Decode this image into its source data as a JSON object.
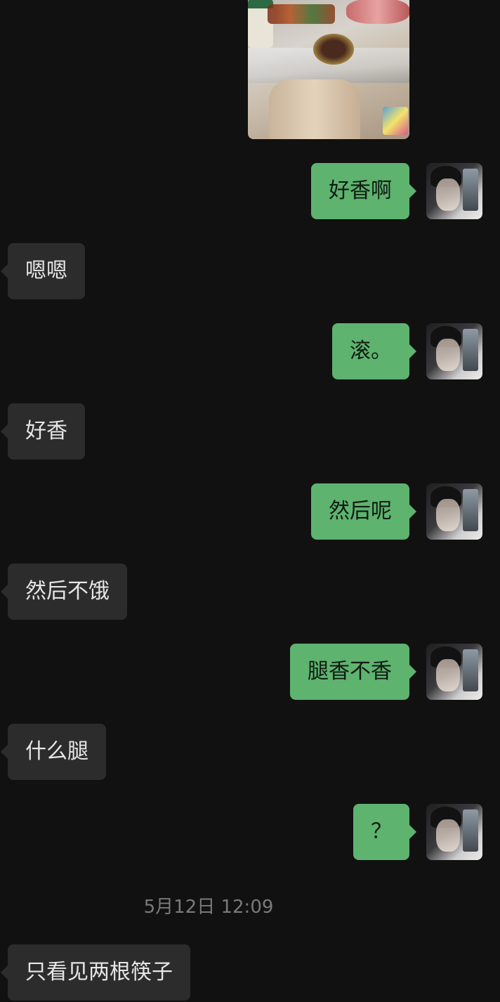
{
  "messages": [
    {
      "side": "me",
      "text": "好香啊"
    },
    {
      "side": "them",
      "text": "嗯嗯"
    },
    {
      "side": "me",
      "text": "滚。"
    },
    {
      "side": "them",
      "text": "好香"
    },
    {
      "side": "me",
      "text": "然后呢"
    },
    {
      "side": "them",
      "text": "然后不饿"
    },
    {
      "side": "me",
      "text": "腿香不香"
    },
    {
      "side": "them",
      "text": "什么腿"
    },
    {
      "side": "me",
      "text": "？"
    },
    {
      "side": "them",
      "text": "只看见两根筷子"
    }
  ],
  "timestamp": "5月12日 12:09",
  "colors": {
    "background": "#111111",
    "my_bubble": "#5eb36f",
    "their_bubble": "#2c2c2c",
    "timestamp": "#7a7a7a"
  }
}
